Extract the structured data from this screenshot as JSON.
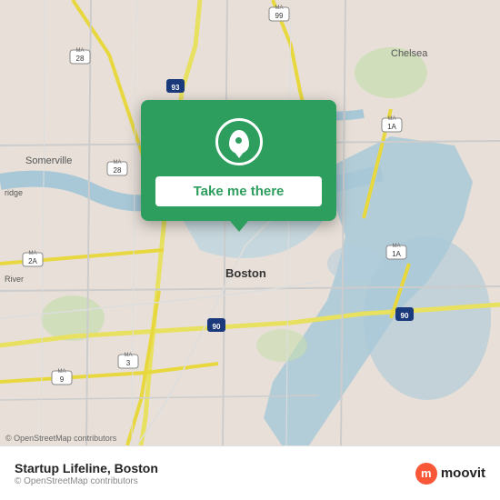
{
  "map": {
    "alt": "Map of Boston area",
    "attribution": "© OpenStreetMap contributors"
  },
  "popup": {
    "button_label": "Take me there",
    "location_icon": "location-pin-icon"
  },
  "bottom_bar": {
    "title": "Startup Lifeline, Boston",
    "copy_label": "© OpenStreetMap contributors",
    "logo_letter": "m",
    "logo_text": "moovit"
  }
}
